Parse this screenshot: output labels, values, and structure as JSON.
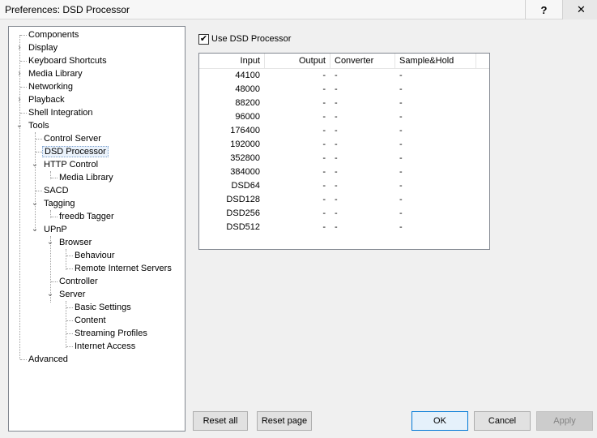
{
  "window": {
    "title": "Preferences: DSD Processor",
    "help_label": "?",
    "close_label": "✕"
  },
  "tree": {
    "items": [
      {
        "label": "Components"
      },
      {
        "label": "Display"
      },
      {
        "label": "Keyboard Shortcuts"
      },
      {
        "label": "Media Library"
      },
      {
        "label": "Networking"
      },
      {
        "label": "Playback"
      },
      {
        "label": "Shell Integration"
      },
      {
        "label": "Tools"
      },
      {
        "label": "Control Server"
      },
      {
        "label": "DSD Processor"
      },
      {
        "label": "HTTP Control"
      },
      {
        "label": "Media Library"
      },
      {
        "label": "SACD"
      },
      {
        "label": "Tagging"
      },
      {
        "label": "freedb Tagger"
      },
      {
        "label": "UPnP"
      },
      {
        "label": "Browser"
      },
      {
        "label": "Behaviour"
      },
      {
        "label": "Remote Internet Servers"
      },
      {
        "label": "Controller"
      },
      {
        "label": "Server"
      },
      {
        "label": "Basic Settings"
      },
      {
        "label": "Content"
      },
      {
        "label": "Streaming Profiles"
      },
      {
        "label": "Internet Access"
      },
      {
        "label": "Advanced"
      }
    ]
  },
  "panel": {
    "use_dsd_label": "Use DSD Processor",
    "use_dsd_checked_glyph": "✔",
    "columns": [
      "Input",
      "Output",
      "Converter",
      "Sample&Hold"
    ],
    "rows": [
      [
        "44100",
        "-",
        "-",
        "-"
      ],
      [
        "48000",
        "-",
        "-",
        "-"
      ],
      [
        "88200",
        "-",
        "-",
        "-"
      ],
      [
        "96000",
        "-",
        "-",
        "-"
      ],
      [
        "176400",
        "-",
        "-",
        "-"
      ],
      [
        "192000",
        "-",
        "-",
        "-"
      ],
      [
        "352800",
        "-",
        "-",
        "-"
      ],
      [
        "384000",
        "-",
        "-",
        "-"
      ],
      [
        "DSD64",
        "-",
        "-",
        "-"
      ],
      [
        "DSD128",
        "-",
        "-",
        "-"
      ],
      [
        "DSD256",
        "-",
        "-",
        "-"
      ],
      [
        "DSD512",
        "-",
        "-",
        "-"
      ]
    ]
  },
  "buttons": {
    "reset_all": "Reset all",
    "reset_page": "Reset page",
    "ok": "OK",
    "cancel": "Cancel",
    "apply": "Apply"
  }
}
